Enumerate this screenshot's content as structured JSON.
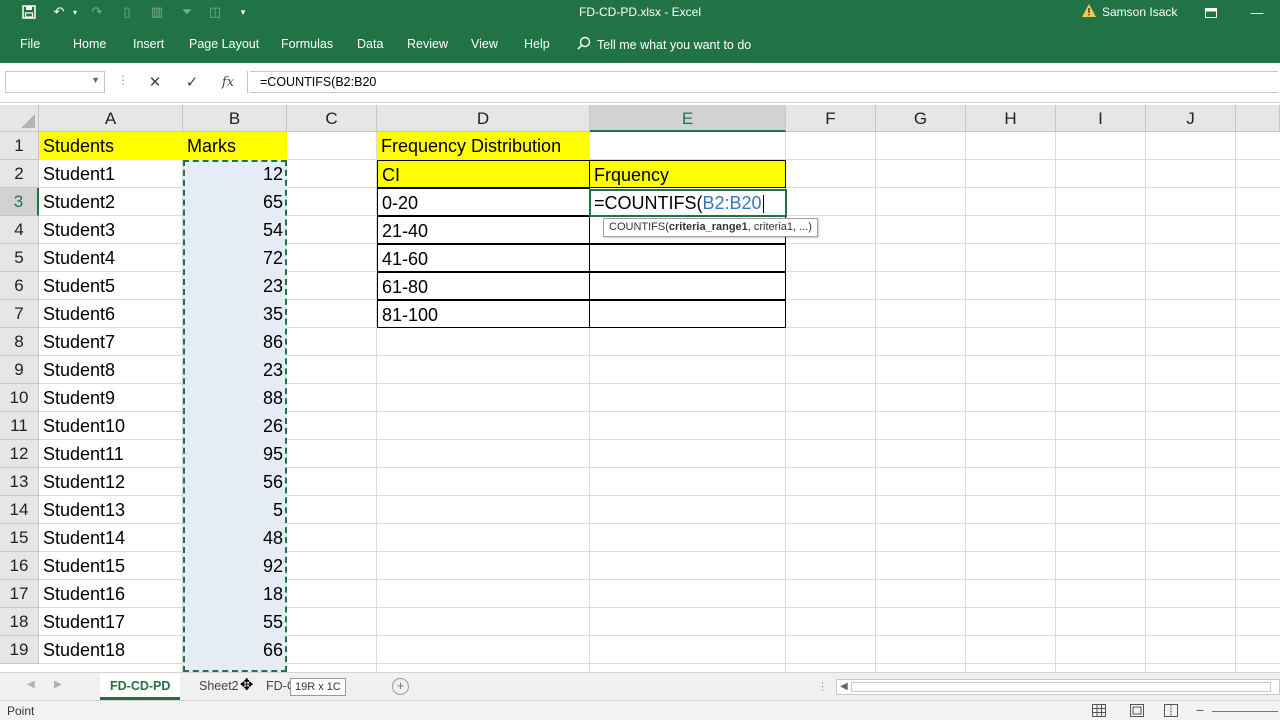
{
  "window": {
    "title": "FD-CD-PD.xlsx  -  Excel",
    "user": "Samson Isack"
  },
  "ribbon": {
    "tabs": [
      "File",
      "Home",
      "Insert",
      "Page Layout",
      "Formulas",
      "Data",
      "Review",
      "View",
      "Help"
    ],
    "tell_me": "Tell me what you want to do"
  },
  "formula_bar": {
    "name_box": "",
    "formula": "=COUNTIFS(B2:B20"
  },
  "columns": [
    "A",
    "B",
    "C",
    "D",
    "E",
    "F",
    "G",
    "H",
    "I",
    "J"
  ],
  "selected_column": "E",
  "selected_row": 3,
  "rows": [
    "1",
    "2",
    "3",
    "4",
    "5",
    "6",
    "7",
    "8",
    "9",
    "10",
    "11",
    "12",
    "13",
    "14",
    "15",
    "16",
    "17",
    "18",
    "19"
  ],
  "data_table": {
    "header_students": "Students",
    "header_marks": "Marks",
    "students": [
      "Student1",
      "Student2",
      "Student3",
      "Student4",
      "Student5",
      "Student6",
      "Student7",
      "Student8",
      "Student9",
      "Student10",
      "Student11",
      "Student12",
      "Student13",
      "Student14",
      "Student15",
      "Student16",
      "Student17",
      "Student18"
    ],
    "marks": [
      12,
      65,
      54,
      72,
      23,
      35,
      86,
      23,
      88,
      26,
      95,
      56,
      5,
      48,
      92,
      18,
      55,
      66
    ]
  },
  "freq_table": {
    "title": "Frequency Distribution",
    "ci_header": "CI",
    "freq_header": "Frquency",
    "intervals": [
      "0-20",
      "21-40",
      "41-60",
      "61-80",
      "81-100"
    ]
  },
  "editing_cell": {
    "prefix": "=COUNTIFS(",
    "ref": "B2:B20",
    "tooltip_func": "COUNTIFS(",
    "tooltip_bold": "criteria_range1",
    "tooltip_rest": ", criteria1, ...)"
  },
  "sheet_tabs": {
    "tabs": [
      "FD-CD-PD",
      "Sheet2",
      "FD-C"
    ],
    "active": "FD-CD-PD",
    "size_tip": "19R x 1C"
  },
  "status": {
    "mode": "Point"
  },
  "colors": {
    "excel_green": "#217346",
    "highlight_yellow": "#ffff00",
    "reference_blue": "#3a75c4"
  }
}
